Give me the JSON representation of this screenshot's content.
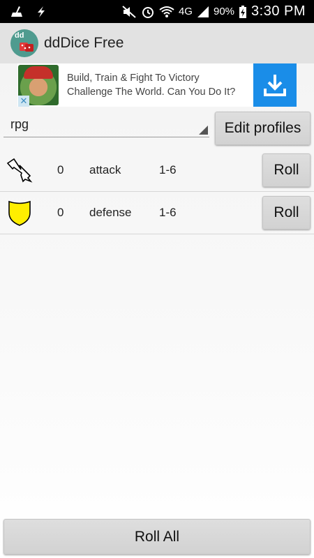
{
  "status_bar": {
    "time": "3:30 PM",
    "battery": "90%",
    "network": "4G"
  },
  "app": {
    "title": "ddDice Free",
    "logo_text": "dd"
  },
  "ad": {
    "line1": "Build, Train & Fight To Victory",
    "line2": "Challenge The World. Can You Do It?",
    "close_glyph": "✕"
  },
  "profile": {
    "selected": "rpg",
    "edit_label": "Edit profiles"
  },
  "dice": [
    {
      "icon": "lightning-icon",
      "count": "0",
      "name": "attack",
      "range": "1-6",
      "roll_label": "Roll"
    },
    {
      "icon": "shield-icon",
      "count": "0",
      "name": "defense",
      "range": "1-6",
      "roll_label": "Roll"
    }
  ],
  "roll_all_label": "Roll All",
  "colors": {
    "action_bar": "#e2e2e2",
    "ad_download": "#1a8de8",
    "shield": "#ffee00",
    "logo_bg": "#4f9b8f"
  }
}
